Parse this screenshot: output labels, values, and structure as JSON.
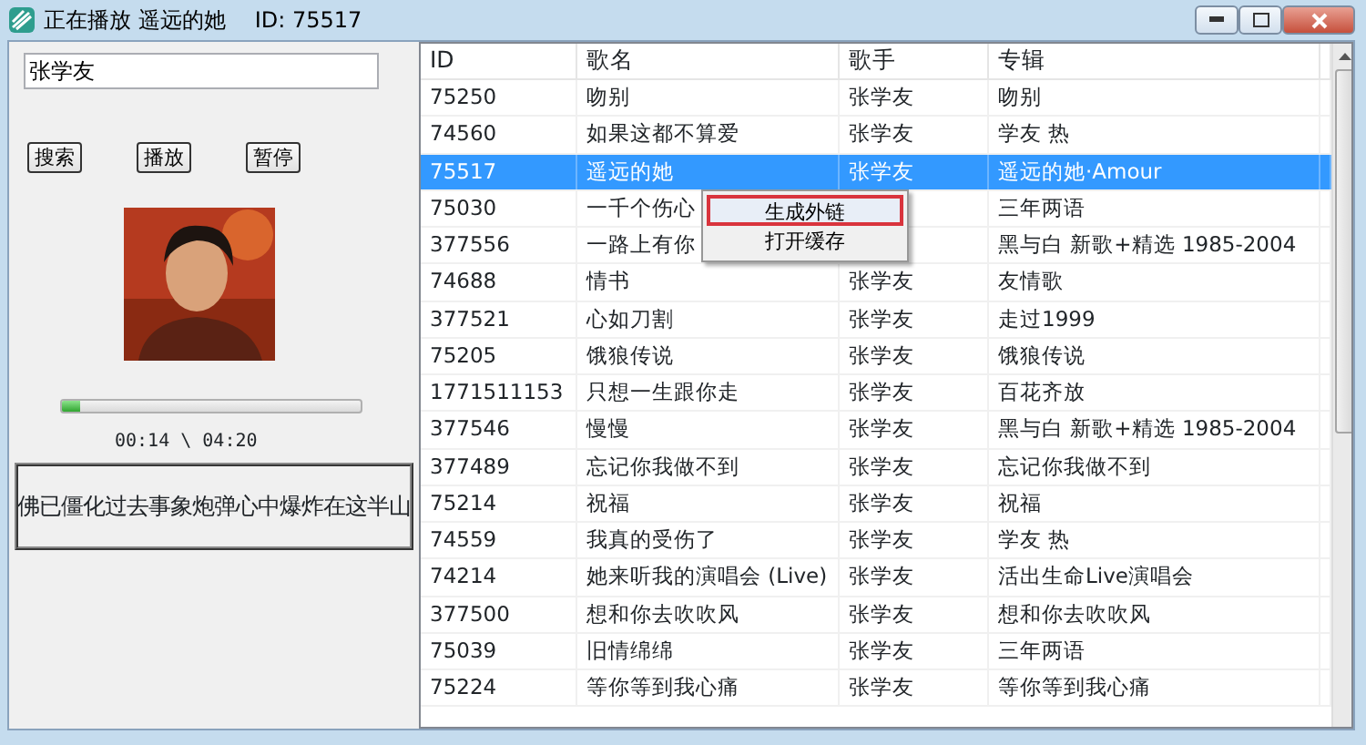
{
  "window": {
    "title": "正在播放 遥远的她",
    "id_label": "ID: 75517"
  },
  "search": {
    "value": "张学友"
  },
  "buttons": [
    "搜索",
    "播放",
    "暂停"
  ],
  "cover": {
    "kind": "picture"
  },
  "progress": {
    "level": 0.06
  },
  "time": "00:14 \\ 04:20",
  "lyrics": "佛已僵化过去事象炮弹心中爆炸在这半山",
  "table": {
    "columns": [
      "ID",
      "歌名",
      "歌手",
      "专辑"
    ],
    "rows": [
      {
        "id": "75250",
        "name": "吻别",
        "artist": "张学友",
        "album": "吻别",
        "selected": false
      },
      {
        "id": "74560",
        "name": "如果这都不算爱",
        "artist": "张学友",
        "album": "学友 热",
        "selected": false
      },
      {
        "id": "75517",
        "name": "遥远的她",
        "artist": "张学友",
        "album": "遥远的她·Amour",
        "selected": true
      },
      {
        "id": "75030",
        "name": "一千个伤心",
        "album": "三年两语",
        "selected": false
      },
      {
        "id": "377556",
        "name": "一路上有你",
        "album": "黑与白 新歌+精选 1985-2004",
        "selected": false
      },
      {
        "id": "74688",
        "name": "情书",
        "artist": "张学友",
        "album": "友情歌",
        "selected": false
      },
      {
        "id": "377521",
        "name": "心如刀割",
        "artist": "张学友",
        "album": "走过1999",
        "selected": false
      },
      {
        "id": "75205",
        "name": "饿狼传说",
        "artist": "张学友",
        "album": "饿狼传说",
        "selected": false
      },
      {
        "id": "1771511153",
        "name": "只想一生跟你走",
        "artist": "张学友",
        "album": "百花齐放",
        "selected": false
      },
      {
        "id": "377546",
        "name": "慢慢",
        "artist": "张学友",
        "album": "黑与白 新歌+精选 1985-2004",
        "selected": false
      },
      {
        "id": "377489",
        "name": "忘记你我做不到",
        "artist": "张学友",
        "album": "忘记你我做不到",
        "selected": false
      },
      {
        "id": "75214",
        "name": "祝福",
        "artist": "张学友",
        "album": "祝福",
        "selected": false
      },
      {
        "id": "74559",
        "name": "我真的受伤了",
        "artist": "张学友",
        "album": "学友 热",
        "selected": false
      },
      {
        "id": "74214",
        "name": "她来听我的演唱会 (Live)",
        "artist": "张学友",
        "album": "活出生命Live演唱会",
        "selected": false
      },
      {
        "id": "377500",
        "name": "想和你去吹吹风",
        "artist": "张学友",
        "album": "想和你去吹吹风",
        "selected": false
      },
      {
        "id": "75039",
        "name": "旧情绵绵",
        "artist": "张学友",
        "album": "三年两语",
        "selected": false
      },
      {
        "id": "75224",
        "name": "等你等到我心痛",
        "artist": "张学友",
        "album": "等你等到我心痛",
        "selected": false
      }
    ]
  },
  "context_menu": [
    {
      "label": "生成外链",
      "selected": true
    },
    {
      "label": "打开缓存",
      "selected": false
    }
  ]
}
